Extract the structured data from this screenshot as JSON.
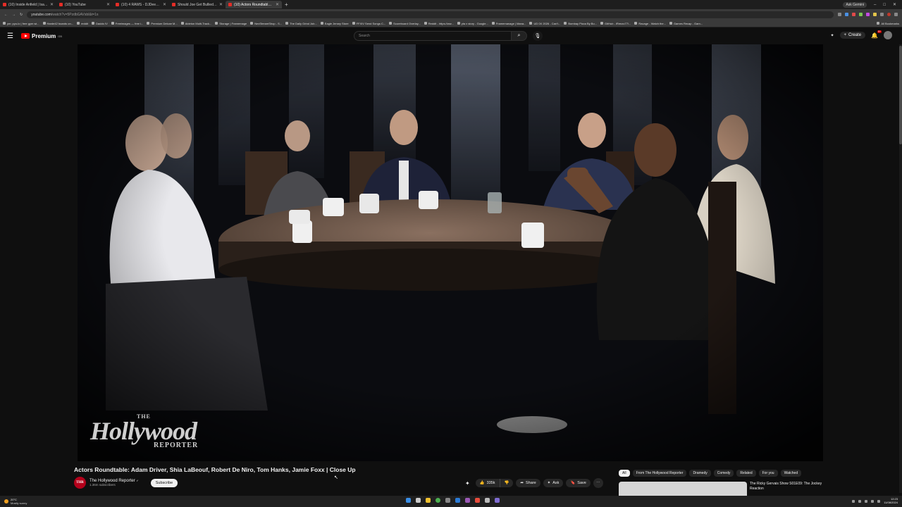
{
  "browser": {
    "tabs": [
      {
        "title": "(10) Inside Anfield | Isak B...",
        "active": false
      },
      {
        "title": "(10) YouTube",
        "active": false
      },
      {
        "title": "(10) 4 RAWS - DJDeeBoi ft. Ti...",
        "active": false
      },
      {
        "title": "Should Joe Get Bullied? | EP 43...",
        "active": false
      },
      {
        "title": "(10) Actors Roundtable: Ad...",
        "active": true
      }
    ],
    "ask_gemini": "Ask Gemini",
    "url_host": "youtube.com",
    "url_path": "/watch?v=5PzdbGAVsbI&t=1s",
    "bookmarks": [
      "ym: pyo-lo | free gym wi...",
      "Harde42 boards on...",
      "reddit",
      "Daddo IV",
      "Freeimages — free i...",
      "Premium Deluxe M...",
      "Ableton Multi-Track...",
      "Storage | Framemage",
      "NexStreamShop - S...",
      "The Daily Grind Job...",
      "Eagle Jersey Store",
      "FFXIV Send Songs C...",
      "Scoreboard Overlay...",
      "Reddit - https://ww...",
      "yta x story - Google...",
      "Framemanage | Mana...",
      "UD 0X 2026 - Can't...",
      "Bombay Pizza By Bo...",
      "GitHub - iRenzo77/...",
      "Ravage - Watch the...",
      "Games Recap - Gam..."
    ],
    "all_bookmarks": "All Bookmarks"
  },
  "header": {
    "brand": "Premium",
    "brand_sup": "GB",
    "search_placeholder": "Search",
    "create_label": "Create",
    "notif_count": "9+"
  },
  "video": {
    "watermark_top": "THE",
    "watermark_main": "Hollywood",
    "watermark_bottom": "REPORTER",
    "title": "Actors Roundtable: Adam Driver, Shia LaBeouf, Robert De Niro, Tom Hanks, Jamie Foxx | Close Up"
  },
  "channel": {
    "logo_text": "THR",
    "name": "The Hollywood Reporter",
    "verified_glyph": "✔",
    "subscribers": "1.36m subscribers",
    "subscribe_label": "Subscribe"
  },
  "actions": {
    "likes": "335k",
    "share": "Share",
    "ask": "Ask",
    "save": "Save"
  },
  "chips": [
    "All",
    "From The Hollywood Reporter",
    "Dramedy",
    "Comedy",
    "Related",
    "For you",
    "Watched"
  ],
  "recommendation": {
    "title": "The Ricky Gervais Show S01E09: The Jockey Reaction"
  },
  "taskbar": {
    "temp": "20°C",
    "weather": "Mostly sunny",
    "time": "12:23",
    "date": "11/08/2024"
  }
}
